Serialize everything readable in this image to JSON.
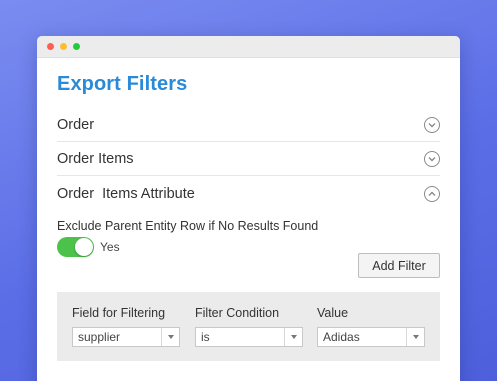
{
  "window": {
    "title": "Export Filters"
  },
  "sections": [
    {
      "label": "Order",
      "state": "collapsed",
      "icon": "chevron-down-icon"
    },
    {
      "label": "Order Items",
      "state": "collapsed",
      "icon": "chevron-down-icon"
    },
    {
      "label": "Order  Items Attribute",
      "state": "expanded",
      "icon": "chevron-up-icon"
    }
  ],
  "exclude": {
    "label": "Exclude Parent Entity Row if No Results Found",
    "toggle_on": true,
    "toggle_text": "Yes"
  },
  "add_filter_label": "Add Filter",
  "filter": {
    "columns": [
      "Field for Filtering",
      "Filter Condition",
      "Value"
    ],
    "field_value": "supplier",
    "condition_value": "is",
    "value_value": "Adidas"
  },
  "colors": {
    "title": "#2a8ad8",
    "toggle_on": "#4cc24a",
    "background": "#5b6de6"
  }
}
